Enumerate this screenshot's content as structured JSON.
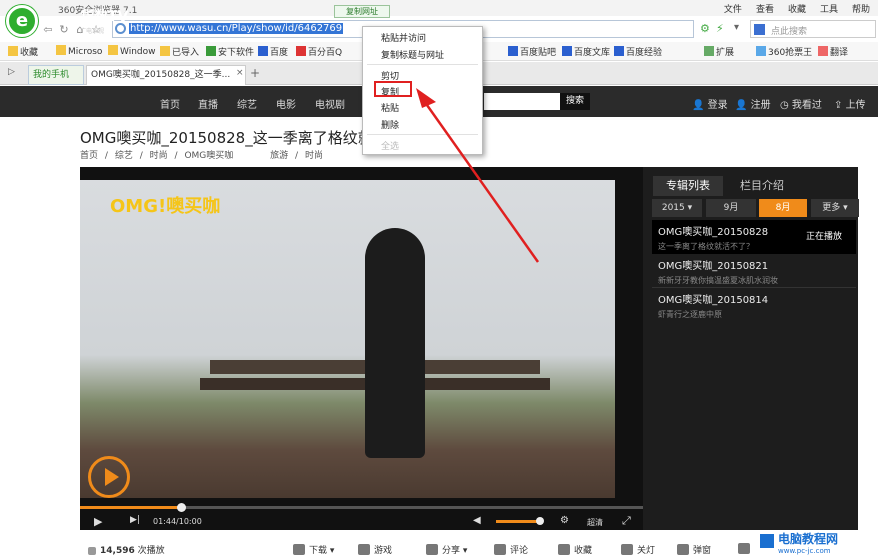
{
  "app": {
    "title": "360安全浏览器 7.1",
    "logo": "e"
  },
  "menu": [
    "文件",
    "查看",
    "收藏",
    "工具",
    "帮助"
  ],
  "copy_url_tip": "复制网址",
  "address": {
    "url": "http://www.wasu.cn/Play/show/id/6462769",
    "search_placeholder": "点此搜索"
  },
  "bookmarks": [
    "收藏",
    "Microso",
    "Window",
    "已导入",
    "安下软件",
    "百度",
    "百分百Q",
    "百度贴吧",
    "百度文库",
    "百度经验",
    "扩展",
    "360抢票王",
    "翻译"
  ],
  "tabs": [
    {
      "label": "我的手机"
    },
    {
      "label": "OMG噢买咖_20150828_这一季..."
    }
  ],
  "site": {
    "logo": "华数TV",
    "logo_sub": "广电系视",
    "nav": [
      "首页",
      "直播",
      "综艺",
      "电影",
      "电视剧"
    ],
    "search_button": "搜索",
    "right_links": [
      "登录",
      "注册",
      "我看过",
      "上传"
    ]
  },
  "video": {
    "title": "OMG噢买咖_20150828_这一季离了格纹就活不了",
    "breadcrumb": [
      "首页",
      "/",
      "综艺",
      "/",
      "时尚",
      "/",
      "OMG噢买咖",
      "旅游",
      "/",
      "时尚"
    ],
    "overlay_logo": "OMG!噢买咖",
    "time": "01:44/10:00",
    "progress_pct": 18,
    "volume_pct": 85,
    "quality": "超清"
  },
  "panel": {
    "tabs": [
      "专辑列表",
      "栏目介绍"
    ],
    "year": "2015",
    "months": [
      "9月",
      "8月"
    ],
    "more": "更多",
    "episodes": [
      {
        "title": "OMG噢买咖_20150828",
        "subtitle": "这一季离了格纹就活不了？",
        "status": "正在播放"
      },
      {
        "title": "OMG噢买咖_20150821",
        "subtitle": "新新牙牙教你搞温盛夏冰肌水润妆"
      },
      {
        "title": "OMG噢买咖_20150814",
        "subtitle": "虾青行之逐鹿中原"
      }
    ]
  },
  "bottom": {
    "play_count": "14,596",
    "play_count_label": "次播放",
    "actions": [
      "下载",
      "游戏",
      "分享",
      "评论",
      "收藏",
      "关灯",
      "弹窗"
    ]
  },
  "context_menu": {
    "items": [
      "粘贴并访问",
      "复制标题与网址",
      "剪切",
      "复制",
      "粘贴",
      "删除",
      "全选"
    ],
    "highlighted": "复制"
  },
  "watermark": {
    "title": "电脑教程网",
    "sub": "www.pc-jc.com"
  },
  "colors": {
    "accent": "#f08b1a",
    "brand_green": "#2fae2f",
    "highlight_red": "#e02020"
  }
}
